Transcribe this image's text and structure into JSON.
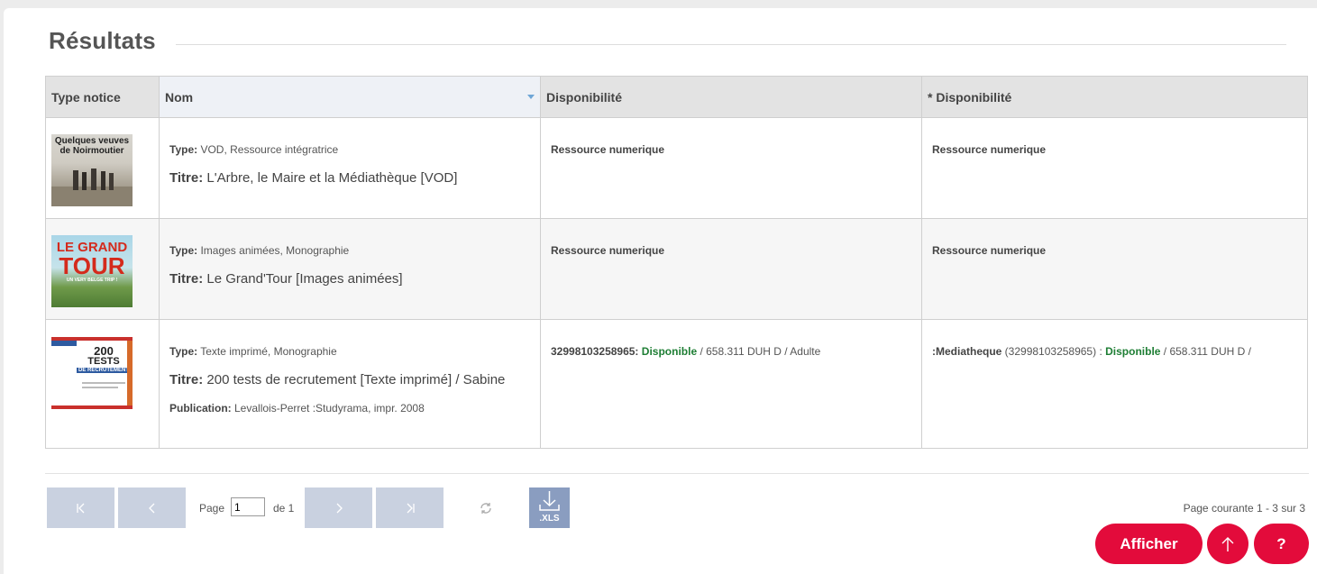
{
  "section": {
    "title": "Résultats"
  },
  "columns": [
    "Type notice",
    "Nom",
    "Disponibilité",
    "* Disponibilité"
  ],
  "rows": [
    {
      "cover_text": [
        "Quelques veuves",
        "de Noirmoutier"
      ],
      "type_label": "Type:",
      "type_value": " VOD, Ressource intégratrice",
      "titre_label": "Titre:",
      "titre_value": " L'Arbre, le Maire et la Médiathèque [VOD]",
      "dispo": "Ressource numerique",
      "dispo2": "Ressource numerique"
    },
    {
      "cover_text": [
        "LE GRAND",
        "TOUR",
        "UN VERY BELGE TRIP !"
      ],
      "type_label": "Type:",
      "type_value": " Images animées, Monographie",
      "titre_label": "Titre:",
      "titre_value": " Le Grand'Tour [Images animées]",
      "dispo": "Ressource numerique",
      "dispo2": "Ressource numerique"
    },
    {
      "cover_text": [
        "200",
        "TESTS",
        "DE RECRUTEMENT"
      ],
      "type_label": "Type:",
      "type_value": " Texte imprimé, Monographie",
      "titre_label": "Titre:",
      "titre_value": " 200 tests de recrutement [Texte imprimé] / Sabine",
      "pub_label": "Publication:",
      "pub_value": " Levallois-Perret :Studyrama, impr. 2008",
      "dispo_barcode": "32998103258965:",
      "dispo_status": "Disponible",
      "dispo_rest": " / 658.311 DUH D / Adulte",
      "dispo2_site": ":Mediatheque",
      "dispo2_barcode": " (32998103258965) : ",
      "dispo2_status": "Disponible",
      "dispo2_rest": " / 658.311 DUH D /"
    }
  ],
  "pager": {
    "page_label": "Page",
    "page_value": "1",
    "of_label": "de 1",
    "xls_label": ".XLS",
    "status": "Page courante 1 - 3 sur 3"
  },
  "actions": {
    "afficher": "Afficher",
    "help": "?"
  },
  "colors": {
    "accent": "#e30b3b",
    "pager": "#c9d1e0",
    "available": "#1e7e34"
  }
}
